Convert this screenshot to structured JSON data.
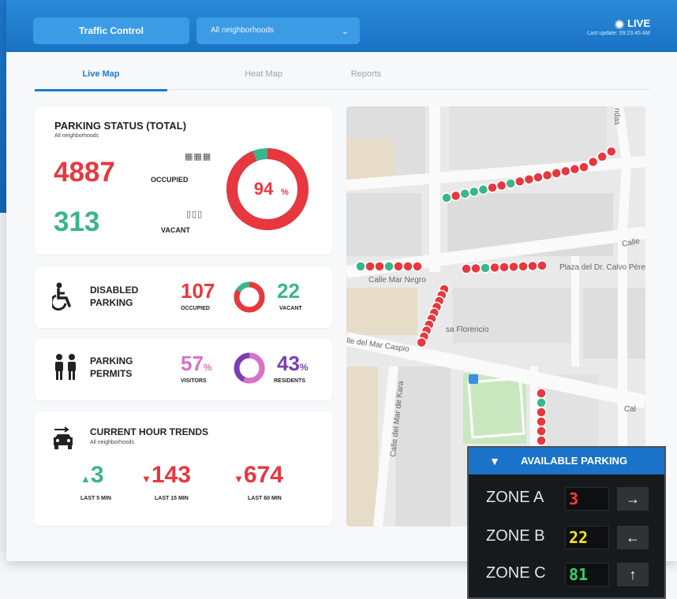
{
  "header": {
    "app_button": "Traffic Control",
    "neighborhood_select": "All neighborhoods",
    "live_label": "LIVE",
    "last_update": "Last update: 09:23:45 AM"
  },
  "tabs": [
    {
      "label": "Live Map",
      "active": true
    },
    {
      "label": "Heat Map",
      "active": false
    },
    {
      "label": "Reports",
      "active": false
    }
  ],
  "parking_status": {
    "title": "PARKING STATUS (TOTAL)",
    "subtitle": "All neighborhoods",
    "occupied_value": "4887",
    "occupied_label": "OCCUPIED",
    "vacant_value": "313",
    "vacant_label": "VACANT",
    "donut_percent": "94",
    "donut_unit": "%",
    "occupied_fraction": 0.94
  },
  "disabled_parking": {
    "title_line1": "DISABLED",
    "title_line2": "PARKING",
    "occupied_value": "107",
    "occupied_label": "OCCUPIED",
    "vacant_value": "22",
    "vacant_label": "VACANT",
    "occupied_fraction": 0.83
  },
  "parking_permits": {
    "title_line1": "PARKING",
    "title_line2": "PERMITS",
    "visitors_value": "57",
    "visitors_label": "VISITORS",
    "residents_value": "43",
    "residents_label": "RESIDENTS",
    "unit": "%",
    "visitors_fraction": 0.57
  },
  "trends": {
    "title": "CURRENT HOUR TRENDS",
    "subtitle": "All neighborhoods",
    "items": [
      {
        "value": "3",
        "label": "LAST 5 MIN",
        "direction": "up"
      },
      {
        "value": "143",
        "label": "LAST 15 MIN",
        "direction": "down"
      },
      {
        "value": "674",
        "label": "LAST 60 MIN",
        "direction": "down"
      }
    ]
  },
  "map": {
    "street_labels": [
      "Calle Mar Negro",
      "Plaza del Dr. Calvo Pérez",
      "lle del Mar Caspio",
      "sa Florencio",
      "Calle del Mar de Kara",
      "Calle",
      "Cal",
      "ndas"
    ]
  },
  "sign": {
    "title": "AVAILABLE PARKING",
    "zones": [
      {
        "name": "ZONE A",
        "value": "3",
        "arrow": "→"
      },
      {
        "name": "ZONE B",
        "value": "22",
        "arrow": "←"
      },
      {
        "name": "ZONE C",
        "value": "81",
        "arrow": "↑"
      }
    ]
  },
  "colors": {
    "red": "#e8373f",
    "green": "#3bb58a",
    "pink": "#d772c8",
    "purple": "#7a3fb0",
    "blue": "#1d7bd0",
    "led_red": "#ff3b3b",
    "led_yellow": "#f6e21d",
    "led_green": "#33d26a"
  }
}
